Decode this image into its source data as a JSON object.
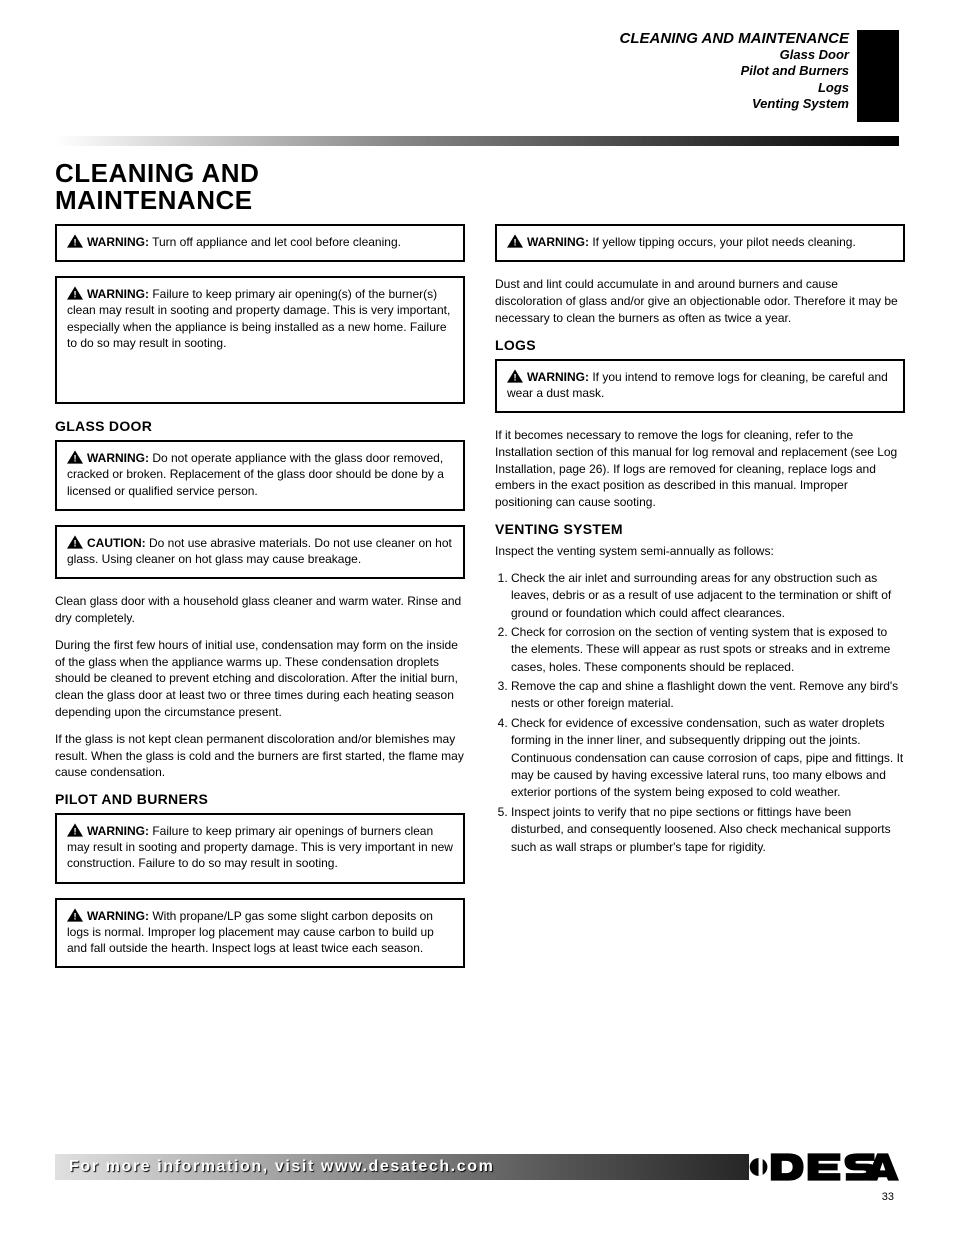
{
  "header": {
    "title": "CLEANING AND MAINTENANCE",
    "sub1": "Glass Door",
    "sub2": "Pilot and Burners",
    "sub3": "Logs",
    "sub4": "Venting System"
  },
  "main_title_line1": "CLEANING AND",
  "main_title_line2": "MAINTENANCE",
  "left": {
    "warn1": {
      "label": "WARNING:",
      "text": " Turn off appliance and let cool before cleaning."
    },
    "warn2": {
      "label": "WARNING:",
      "text": " Failure to keep primary air opening(s) of the burner(s) clean may result in sooting and property damage. This is very important, especially when the appliance is being installed as a new home. Failure to do so may result in sooting."
    },
    "glass": {
      "heading": "GLASS DOOR",
      "warn1": {
        "label": "WARNING:",
        "text": " Do not operate appliance with the glass door removed, cracked or broken. Replacement of the glass door should be done by a licensed or qualified service person."
      },
      "warn2": {
        "label": "CAUTION:",
        "text": " Do not use abrasive materials. Do not use cleaner on hot glass. Using cleaner on hot glass may cause breakage."
      },
      "p1": "Clean glass door with a household glass cleaner and warm water. Rinse and dry completely.",
      "p2": "During the first few hours of initial use, condensation may form on the inside of the glass when the appliance warms up. These condensation droplets should be cleaned to prevent etching and discoloration. After the initial burn, clean the glass door at least two or three times during each heating season depending upon the circumstance present.",
      "p3": "If the glass is not kept clean permanent discoloration and/or blemishes may result. When the glass is cold and the burners are first started, the flame may cause condensation."
    },
    "pilot": {
      "heading": "PILOT AND BURNERS",
      "warn1": {
        "label": "WARNING:",
        "text": " Failure to keep primary air openings of burners clean may result in sooting and property damage. This is very important in new construction. Failure to do so may result in sooting."
      },
      "warn2": {
        "label": "WARNING:",
        "text": " With propane/LP gas some slight carbon deposits on logs is normal. Improper log placement may cause carbon to build up and fall outside the hearth. Inspect logs at least twice each season."
      }
    }
  },
  "right": {
    "warn1": {
      "label": "WARNING:",
      "text": " If yellow tipping occurs, your pilot needs cleaning."
    },
    "p1": "Dust and lint could accumulate in and around burners and cause discoloration of glass and/or give an objectionable odor. Therefore it may be necessary to clean the burners as often as twice a year.",
    "logs": {
      "heading": "LOGS",
      "warn": {
        "label": "WARNING:",
        "text": " If you intend to remove logs for cleaning, be careful and wear a dust mask."
      },
      "p1": "If it becomes necessary to remove the logs for cleaning, refer to the Installation section of this manual for log removal and replacement (see Log Installation, page 26). If logs are removed for cleaning, replace logs and embers in the exact position as described in this manual. Improper positioning can cause sooting."
    },
    "venting": {
      "heading": "VENTING SYSTEM",
      "intro": "Inspect the venting system semi-annually as follows:",
      "items": [
        "Check the air inlet and surrounding areas for any obstruction such as leaves, debris or as a result of use adjacent to the termination or shift of ground or foundation which could affect clearances.",
        "Check for corrosion on the section of venting system that is exposed to the elements. These will appear as rust spots or streaks and in extreme cases, holes. These components should be replaced.",
        "Remove the cap and shine a flashlight down the vent. Remove any bird's nests or other foreign material.",
        "Check for evidence of excessive condensation, such as water droplets forming in the inner liner, and subsequently dripping out the joints. Continuous condensation can cause corrosion of caps, pipe and fittings. It may be caused by having excessive lateral runs, too many elbows and exterior portions of the system being exposed to cold weather.",
        "Inspect joints to verify that no pipe sections or fittings have been disturbed, and consequently loosened. Also check mechanical supports such as wall straps or plumber's tape for rigidity."
      ]
    }
  },
  "footer": "For more information, visit www.desatech.com",
  "page_number": "33"
}
